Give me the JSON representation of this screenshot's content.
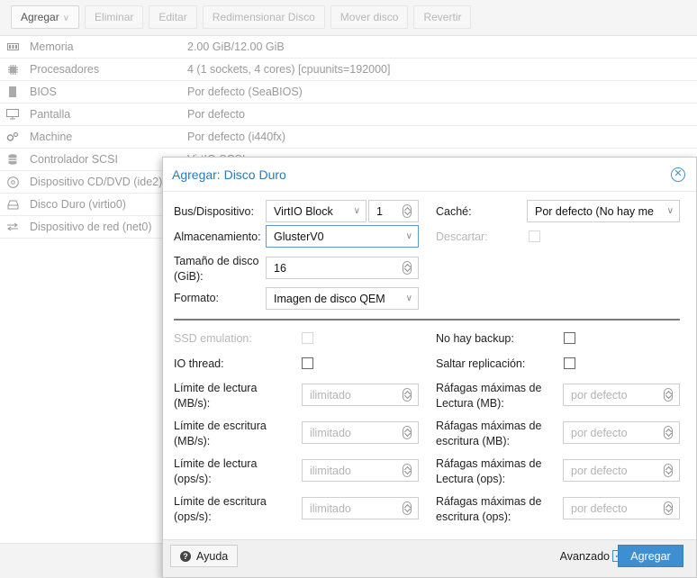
{
  "toolbar": {
    "buttons": [
      {
        "label": "Agregar",
        "enabled": true
      },
      {
        "label": "Eliminar",
        "enabled": false
      },
      {
        "label": "Editar",
        "enabled": false
      },
      {
        "label": "Redimensionar Disco",
        "enabled": false
      },
      {
        "label": "Mover disco",
        "enabled": false
      },
      {
        "label": "Revertir",
        "enabled": false
      }
    ]
  },
  "hardware": [
    {
      "icon": "memory-icon",
      "key": "Memoria",
      "value": "2.00 GiB/12.00 GiB"
    },
    {
      "icon": "cpu-icon",
      "key": "Procesadores",
      "value": "4 (1 sockets, 4 cores) [cpuunits=192000]"
    },
    {
      "icon": "bios-icon",
      "key": "BIOS",
      "value": "Por defecto (SeaBIOS)"
    },
    {
      "icon": "display-icon",
      "key": "Pantalla",
      "value": "Por defecto"
    },
    {
      "icon": "gears-icon",
      "key": "Machine",
      "value": "Por defecto (i440fx)"
    },
    {
      "icon": "database-icon",
      "key": "Controlador SCSI",
      "value": "VirtIO SCSI"
    },
    {
      "icon": "cdrom-icon",
      "key": "Dispositivo CD/DVD (ide2)",
      "value": ""
    },
    {
      "icon": "harddisk-icon",
      "key": "Disco Duro (virtio0)",
      "value": ""
    },
    {
      "icon": "network-icon",
      "key": "Dispositivo de red (net0)",
      "value": ""
    }
  ],
  "dialog": {
    "title": "Agregar: Disco Duro",
    "bus_label": "Bus/Dispositivo:",
    "bus_value": "VirtIO Block",
    "device_value": "1",
    "storage_label": "Almacenamiento:",
    "storage_value": "GlusterV0",
    "size_label": "Tamaño de disco (GiB):",
    "size_value": "16",
    "format_label": "Formato:",
    "format_value": "Imagen de disco QEMU",
    "cache_label": "Caché:",
    "cache_value": "Por defecto (No hay me",
    "discard_label": "Descartar:",
    "ssd_label": "SSD emulation:",
    "iothread_label": "IO thread:",
    "nobackup_label": "No hay backup:",
    "skiprepl_label": "Saltar replicación:",
    "read_mbs_label": "Límite de lectura (MB/s):",
    "write_mbs_label": "Límite de escritura (MB/s):",
    "read_ops_label": "Límite de lectura (ops/s):",
    "write_ops_label": "Límite de escritura (ops/s):",
    "burst_read_mb_label": "Ráfagas máximas de Lectura (MB):",
    "burst_write_mb_label": "Ráfagas máximas de escritura (MB):",
    "burst_read_ops_label": "Ráfagas máximas de Lectura (ops):",
    "burst_write_ops_label": "Ráfagas máximas de escritura (ops):",
    "unlimited_placeholder": "ilimitado",
    "default_placeholder": "por defecto",
    "help_label": "Ayuda",
    "advanced_label": "Avanzado",
    "advanced_checked": true,
    "submit_label": "Agregar"
  },
  "colors": {
    "accent": "#3d8fd1",
    "title": "#2a7ab8"
  }
}
